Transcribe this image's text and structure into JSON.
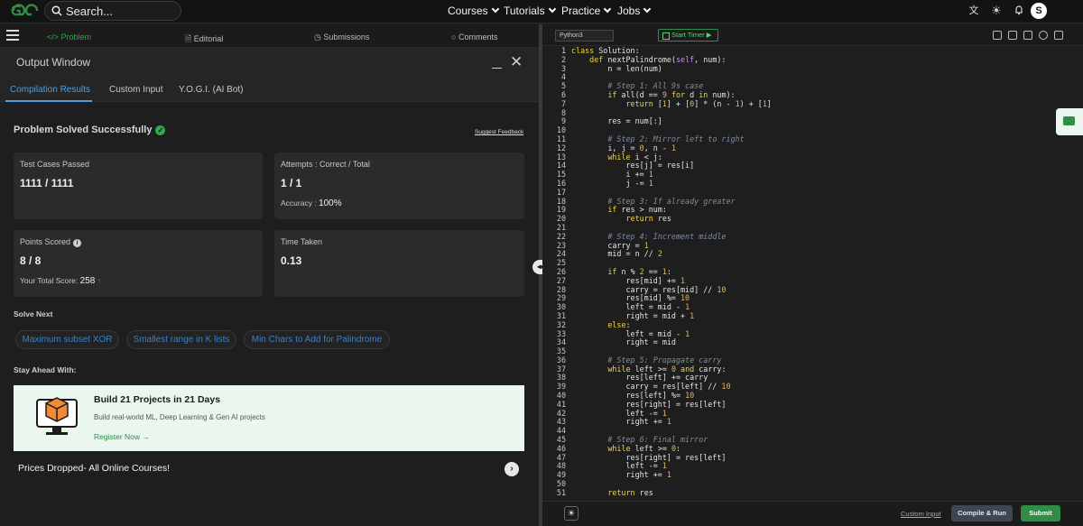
{
  "topbar": {
    "logo": "GfG",
    "search_label": "Search...",
    "nav": [
      "Courses",
      "Tutorials",
      "Practice",
      "Jobs"
    ],
    "avatar": "S"
  },
  "subbar": {
    "tabs": [
      "Problem",
      "Editorial",
      "Submissions",
      "Comments"
    ]
  },
  "output": {
    "title": "Output Window",
    "tabs": [
      "Compilation Results",
      "Custom Input",
      "Y.O.G.I. (AI Bot)"
    ],
    "status": "Problem Solved Successfully",
    "feedback": "Suggest Feedback",
    "cards": {
      "tests_label": "Test Cases Passed",
      "tests_value": "1111 / 1111",
      "attempts_label": "Attempts : Correct / Total",
      "attempts_value": "1 / 1",
      "accuracy_label": "Accuracy :",
      "accuracy_value": "100%",
      "points_label": "Points Scored",
      "points_value": "8 / 8",
      "score_label": "Your Total Score:",
      "score_value": "258",
      "time_label": "Time Taken",
      "time_value": "0.13"
    },
    "solve_next": "Solve Next",
    "chips": [
      "Maximum subset XOR",
      "Smallest range in K lists",
      "Min Chars to Add for Palindrome"
    ],
    "stay_ahead": "Stay Ahead With:",
    "promo": {
      "title": "Build 21 Projects in 21 Days",
      "subtitle": "Build real-world ML, Deep Learning & Gen AI projects",
      "link": "Register Now"
    },
    "prices": "Prices Dropped- All Online Courses!"
  },
  "editor": {
    "language": "Python3",
    "timer": "Start Timer",
    "custom_input": "Custom Input",
    "compile": "Compile & Run",
    "submit": "Submit"
  }
}
